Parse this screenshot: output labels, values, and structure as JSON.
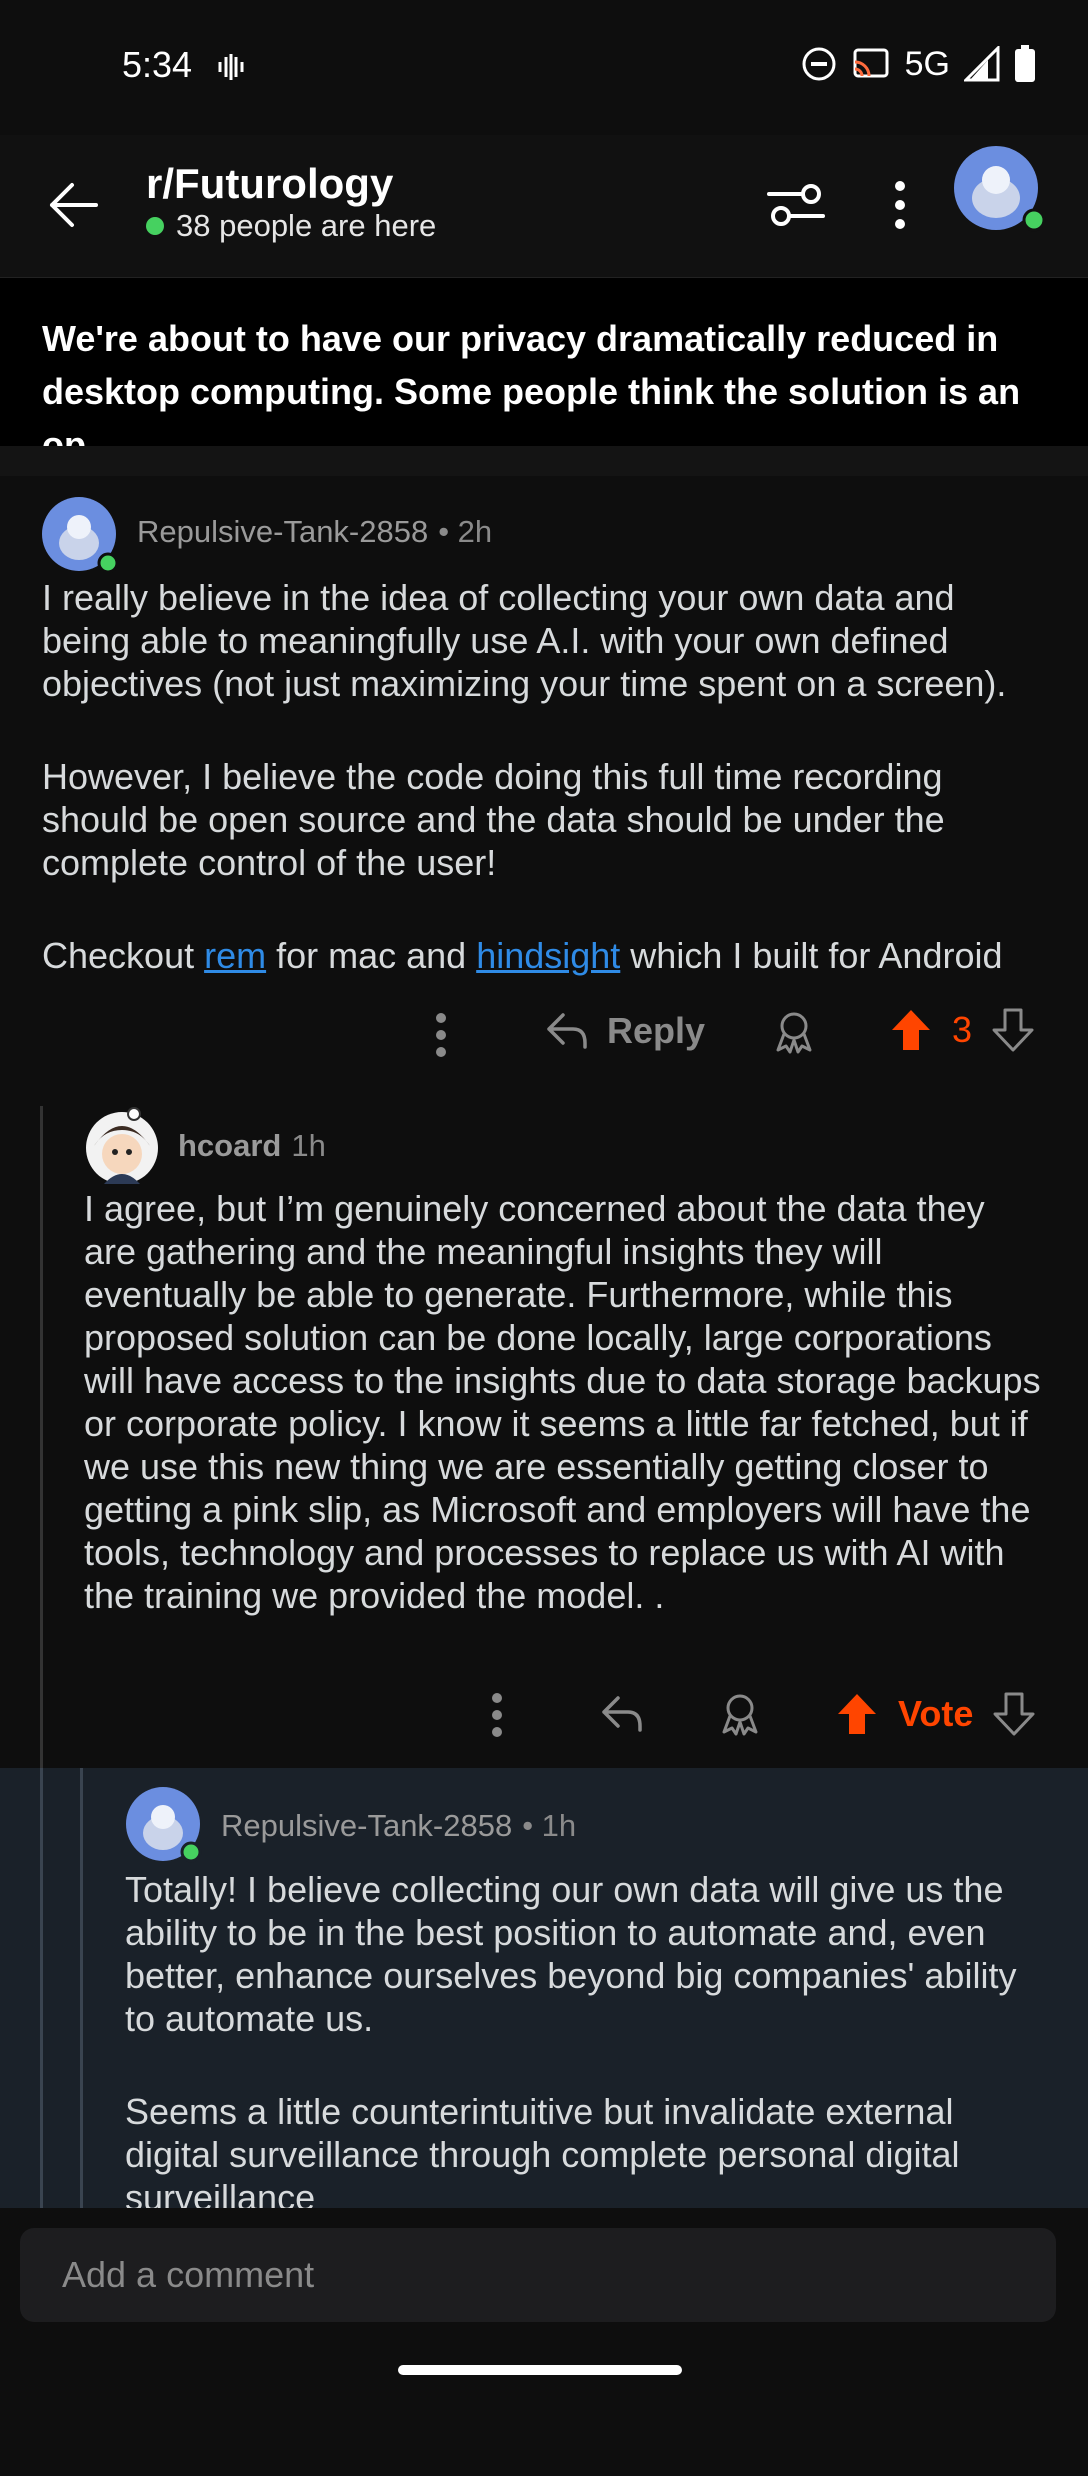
{
  "status": {
    "time": "5:34",
    "network": "5G"
  },
  "header": {
    "subreddit": "r/Futurology",
    "online": "38 people are here"
  },
  "post": {
    "title": "We're about to have our privacy dramatically reduced in desktop computing. Some people think the solution is an op..."
  },
  "comments": [
    {
      "user": "Repulsive-Tank-2858",
      "age": "• 2h",
      "p1": "I really believe in the idea of collecting your own data and being able to meaningfully use A.I. with your own defined objectives (not just maximizing your time spent on a screen).",
      "p2": "However, I believe the code doing this full time recording should be open source and the data should be under the complete control of the user!",
      "p3_pre": "Checkout ",
      "link1": "rem",
      "p3_mid": " for mac and ",
      "link2": "hindsight",
      "p3_post": " which I built for Android",
      "reply_label": "Reply",
      "votes": "3"
    },
    {
      "user": "hcoard",
      "age": "1h",
      "text": "I agree, but I’m genuinely concerned about the data they are gathering and the meaningful insights they will eventually be able to generate. Furthermore, while this proposed solution can be done locally, large corporations will have access to the insights due to data storage backups or corporate policy. I know it seems a little far fetched, but if we use this new thing we are essentially getting closer to getting a pink slip, as Microsoft and employers will have the tools, technology and processes to replace us with AI with the training we provided the model. .",
      "votes": "Vote"
    },
    {
      "user": "Repulsive-Tank-2858",
      "age": "• 1h",
      "p1": "Totally! I believe collecting our own data will give us the ability to be in the best position to automate and, even better, enhance ourselves beyond big companies' ability to automate us.",
      "p2": "Seems a little counterintuitive but invalidate external digital surveillance through complete personal digital surveillance"
    }
  ],
  "composer": {
    "placeholder": "Add a comment"
  },
  "colors": {
    "upvote": "#ff4500",
    "link": "#2f8be6",
    "online": "#46d160"
  }
}
